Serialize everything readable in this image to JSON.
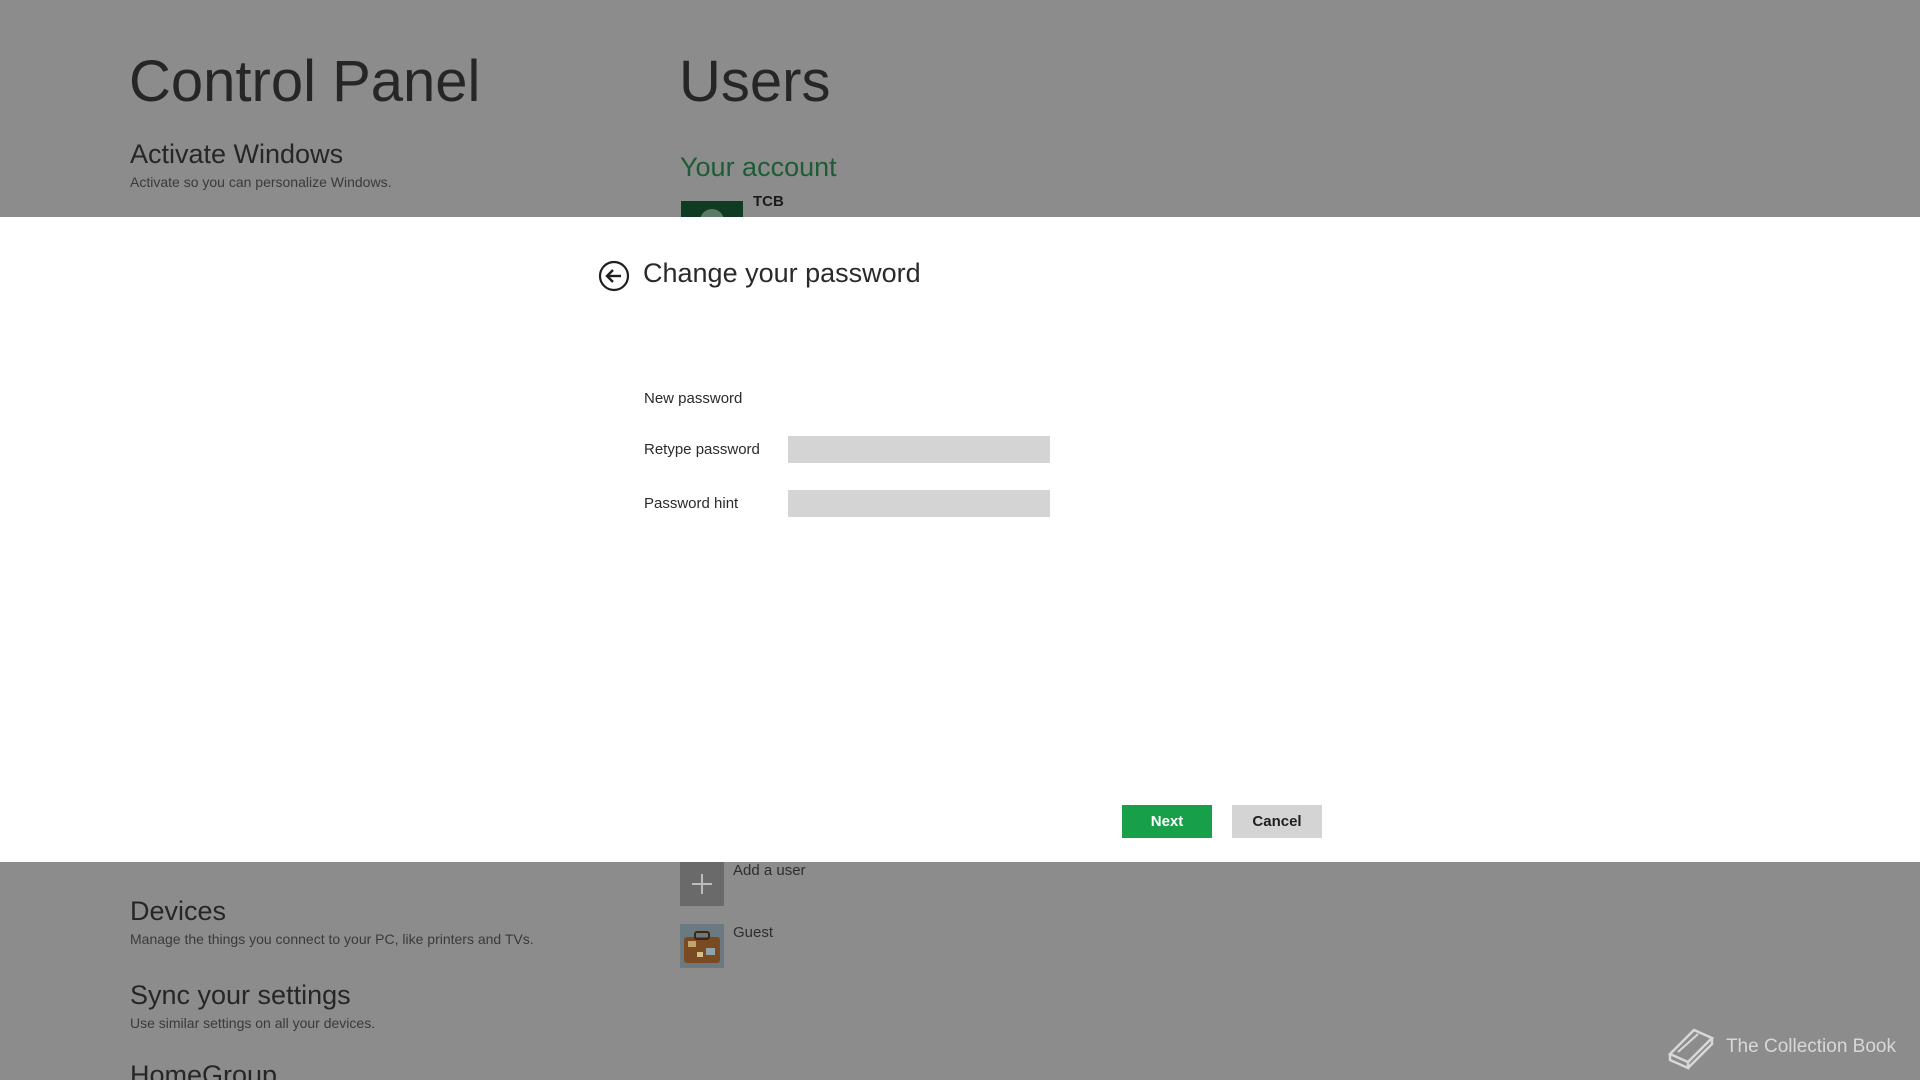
{
  "background": {
    "control_panel_title": "Control Panel",
    "users_title": "Users",
    "left_items": {
      "activate": {
        "title": "Activate Windows",
        "subtitle": "Activate so you can personalize Windows."
      },
      "devices": {
        "title": "Devices",
        "subtitle": "Manage the things you connect to your PC, like printers and TVs."
      },
      "sync": {
        "title": "Sync your settings",
        "subtitle": "Use similar settings on all your devices."
      },
      "homegroup": {
        "title": "HomeGroup"
      }
    },
    "your_account_heading": "Your account",
    "account_name": "TCB",
    "add_user_label": "Add a user",
    "guest_label": "Guest"
  },
  "dialog": {
    "title": "Change your password",
    "fields": {
      "new_password": {
        "label": "New password",
        "value": ""
      },
      "retype_password": {
        "label": "Retype password",
        "value": ""
      },
      "password_hint": {
        "label": "Password hint",
        "value": ""
      }
    },
    "next_label": "Next",
    "cancel_label": "Cancel"
  },
  "watermark": {
    "text": "The Collection Book"
  },
  "colors": {
    "backdrop": "#8c8c8c",
    "accent_green": "#17a049",
    "account_heading_green": "#1d5c35",
    "input_gray": "#d4d4d4"
  }
}
